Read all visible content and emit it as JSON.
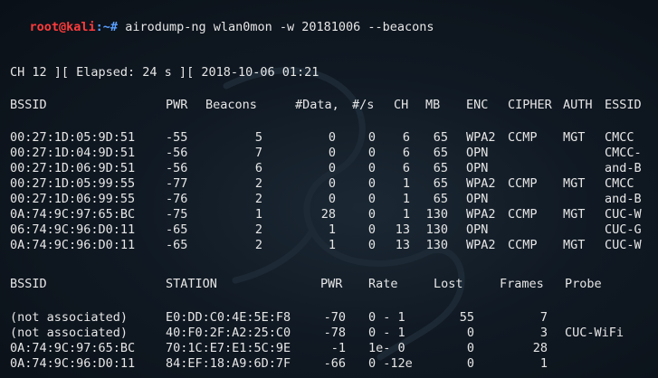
{
  "prompt": {
    "user_host": "root@kali",
    "path": ":~#",
    "command": " airodump-ng wlan0mon -w 20181006 --beacons"
  },
  "status_line": "CH 12 ][ Elapsed: 24 s ][ 2018-10-06 01:21",
  "ap_table": {
    "headers": [
      "BSSID",
      "PWR",
      "Beacons",
      "#Data,",
      "#/s",
      "CH",
      "MB",
      "ENC",
      "CIPHER",
      "AUTH",
      "ESSID"
    ],
    "rows": [
      [
        "00:27:1D:05:9D:51",
        "-55",
        "5",
        "0",
        "0",
        "6",
        "65",
        "WPA2",
        "CCMP",
        "MGT",
        "CMCC"
      ],
      [
        "00:27:1D:04:9D:51",
        "-56",
        "7",
        "0",
        "0",
        "6",
        "65",
        "OPN",
        "",
        "",
        "CMCC-"
      ],
      [
        "00:27:1D:06:9D:51",
        "-56",
        "6",
        "0",
        "0",
        "6",
        "65",
        "OPN",
        "",
        "",
        "and-B"
      ],
      [
        "00:27:1D:05:99:55",
        "-77",
        "2",
        "0",
        "0",
        "1",
        "65",
        "WPA2",
        "CCMP",
        "MGT",
        "CMCC"
      ],
      [
        "00:27:1D:06:99:55",
        "-76",
        "2",
        "0",
        "0",
        "1",
        "65",
        "OPN",
        "",
        "",
        "and-B"
      ],
      [
        "0A:74:9C:97:65:BC",
        "-75",
        "1",
        "28",
        "0",
        "1",
        "130",
        "WPA2",
        "CCMP",
        "MGT",
        "CUC-W"
      ],
      [
        "06:74:9C:96:D0:11",
        "-65",
        "2",
        "1",
        "0",
        "13",
        "130",
        "OPN",
        "",
        "",
        "CUC-G"
      ],
      [
        "0A:74:9C:96:D0:11",
        "-65",
        "2",
        "1",
        "0",
        "13",
        "130",
        "WPA2",
        "CCMP",
        "MGT",
        "CUC-W"
      ]
    ]
  },
  "station_table": {
    "headers": [
      "BSSID",
      "STATION",
      "PWR",
      "Rate",
      "Lost",
      "Frames",
      "Probe"
    ],
    "rows": [
      [
        "(not associated)",
        "E0:DD:C0:4E:5E:F8",
        "-70",
        "0 - 1",
        "55",
        "7",
        ""
      ],
      [
        "(not associated)",
        "40:F0:2F:A2:25:C0",
        "-78",
        "0 - 1",
        "0",
        "3",
        "CUC-WiFi"
      ],
      [
        "0A:74:9C:97:65:BC",
        "70:1C:E7:E1:5C:9E",
        "-1",
        "1e- 0",
        "0",
        "28",
        ""
      ],
      [
        "0A:74:9C:96:D0:11",
        "84:EF:18:A9:6D:7F",
        "-66",
        "0 -12e",
        "0",
        "1",
        ""
      ]
    ]
  }
}
